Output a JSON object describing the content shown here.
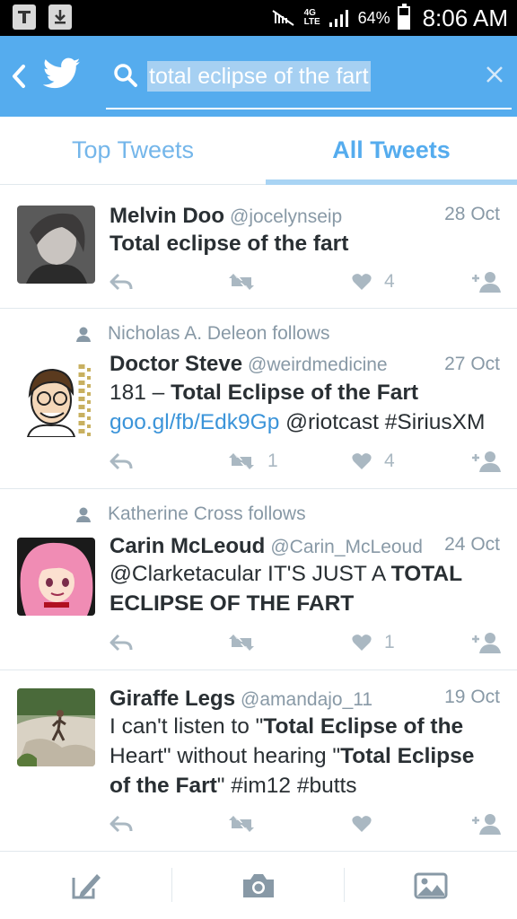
{
  "status_bar": {
    "network": "4G LTE",
    "battery": "64%",
    "time": "8:06 AM"
  },
  "search": {
    "query": "total eclipse of the fart"
  },
  "tabs": [
    {
      "label": "Top Tweets",
      "selected": false
    },
    {
      "label": "All Tweets",
      "selected": true
    }
  ],
  "tweets": [
    {
      "context": "",
      "name": "Melvin Doo",
      "handle": "@jocelynseip",
      "date": "28 Oct",
      "retweets": "",
      "likes": "4"
    },
    {
      "context": "Nicholas A. Deleon  follows",
      "name": "Doctor Steve",
      "handle": "@weirdmedicine",
      "date": "27 Oct",
      "retweets": "1",
      "likes": "4"
    },
    {
      "context": "Katherine Cross follows",
      "name": "Carin McLeoud",
      "handle": "@Carin_McLeoud",
      "date": "24 Oct",
      "retweets": "",
      "likes": "1"
    },
    {
      "context": "",
      "name": "Giraffe Legs",
      "handle": "@amandajo_11",
      "date": "19 Oct",
      "retweets": "",
      "likes": ""
    }
  ],
  "tweet_text": {
    "t0": {
      "b1": "Total eclipse of the fart"
    },
    "t1": {
      "p1": "181 – ",
      "b1": "Total Eclipse of the Fart",
      "link": "goo.gl/fb/Edk9Gp",
      "p2": "@riotcast #SiriusXM"
    },
    "t2": {
      "p1": "@Clarketacular IT'S JUST A ",
      "b1": "TOTAL ECLIPSE OF THE FART"
    },
    "t3": {
      "p1": "I can't listen to \"",
      "b1": "Total Eclipse of the",
      "p2": "Heart\" without hearing \"",
      "b2": "Total Eclipse",
      "b3": "of the Fart",
      "p3": "\" #im12 #butts"
    }
  },
  "colors": {
    "accent": "#55acee",
    "meta": "#8899a6",
    "action": "#aab8c2",
    "link": "#3b94d9"
  },
  "icons": [
    "back-icon",
    "twitter-bird-icon",
    "search-icon",
    "clear-icon",
    "reply-icon",
    "retweet-icon",
    "heart-icon",
    "follow-icon",
    "compose-icon",
    "camera-icon",
    "photo-icon"
  ]
}
